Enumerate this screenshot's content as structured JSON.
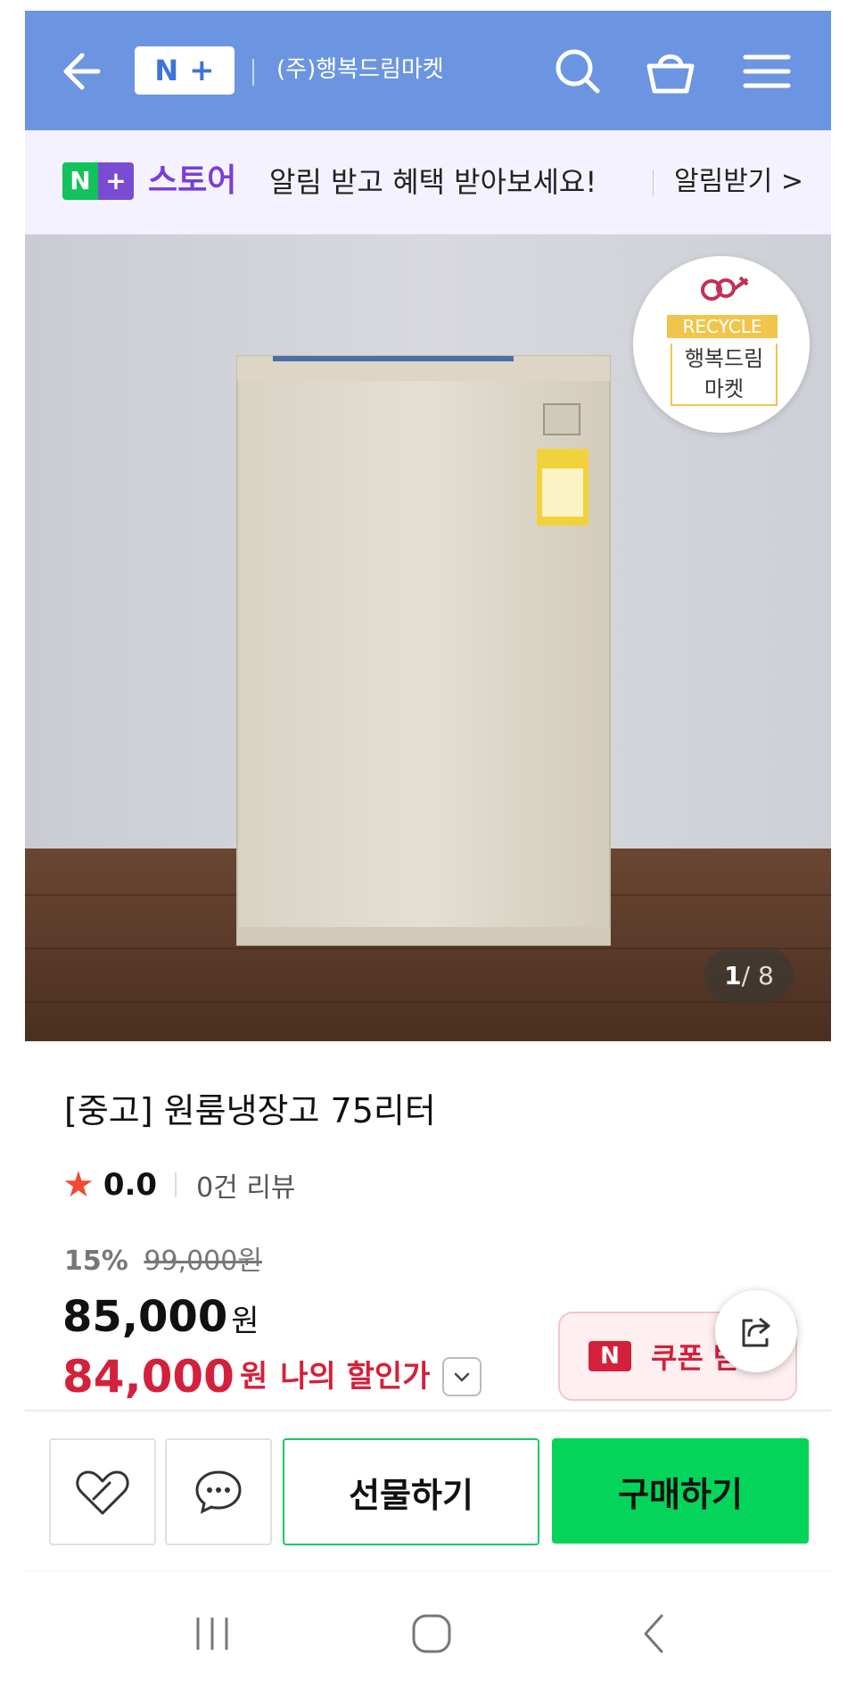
{
  "header": {
    "logo_n": "N",
    "logo_plus": "+",
    "store_name": "(주)행복드림마켓"
  },
  "promo": {
    "badge_n": "N",
    "badge_plus": "+",
    "store_label": "스토어",
    "message": "알림 받고 혜택 받아보세요!",
    "alarm_button": "알림받기 >"
  },
  "image": {
    "sticker_top": "RECYCLE",
    "sticker_line1": "행복드림",
    "sticker_line2": "마켓",
    "counter_current": "1",
    "counter_total": "/ 8"
  },
  "product": {
    "title": "[중고] 원룸냉장고 75리터",
    "rating": "0.0",
    "review_count": "0건 리뷰",
    "discount_pct": "15%",
    "original_price": "99,000원",
    "price": "85,000",
    "price_unit": "원",
    "my_price": "84,000",
    "my_price_unit": "원",
    "my_price_label": "나의 할인가"
  },
  "coupon": {
    "badge": "N",
    "label": "쿠폰 받기"
  },
  "actions": {
    "gift": "선물하기",
    "buy": "구매하기"
  },
  "colors": {
    "header_bg": "#6b95e0",
    "accent_red": "#d4213b",
    "buy_green": "#05d45a"
  }
}
